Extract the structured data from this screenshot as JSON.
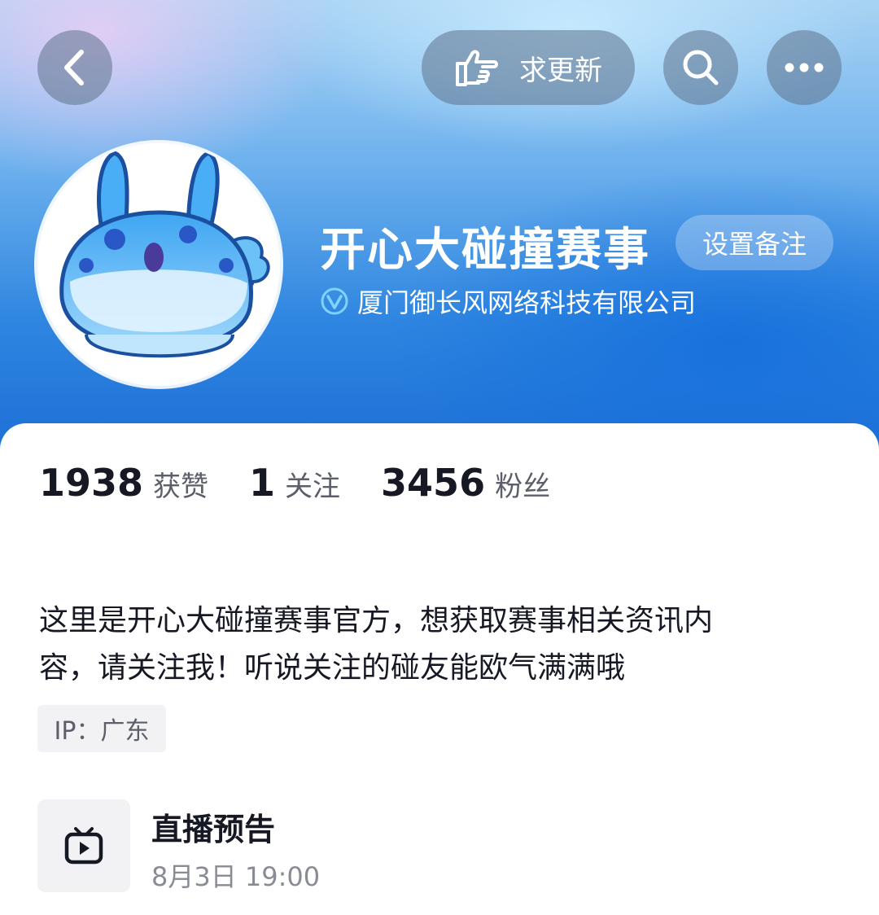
{
  "topbar": {
    "back_icon": "chevron-left-icon",
    "request_update_label": "求更新",
    "request_update_icon": "pointing-hand-icon",
    "search_icon": "search-icon",
    "more_icon": "more-dots-icon"
  },
  "profile": {
    "name": "开心大碰撞赛事",
    "set_remark_label": "设置备注",
    "verified_icon": "verified-v-icon",
    "company": "厦门御长风网络科技有限公司"
  },
  "stats": [
    {
      "value": "1938",
      "label": "获赞"
    },
    {
      "value": "1",
      "label": "关注"
    },
    {
      "value": "3456",
      "label": "粉丝"
    }
  ],
  "bio": {
    "line1": "这里是开心大碰撞赛事官方，想获取赛事相关资讯内",
    "line2": "容，请关注我！听说关注的碰友能欧气满满哦"
  },
  "ip": "IP：广东",
  "live": {
    "icon": "tv-play-icon",
    "title": "直播预告",
    "time": "8月3日 19:00"
  },
  "colors": {
    "header_top": "#a9d3f3",
    "header_bottom": "#1d6fd6",
    "text_primary": "#161823",
    "text_secondary": "#5c5f6a"
  }
}
